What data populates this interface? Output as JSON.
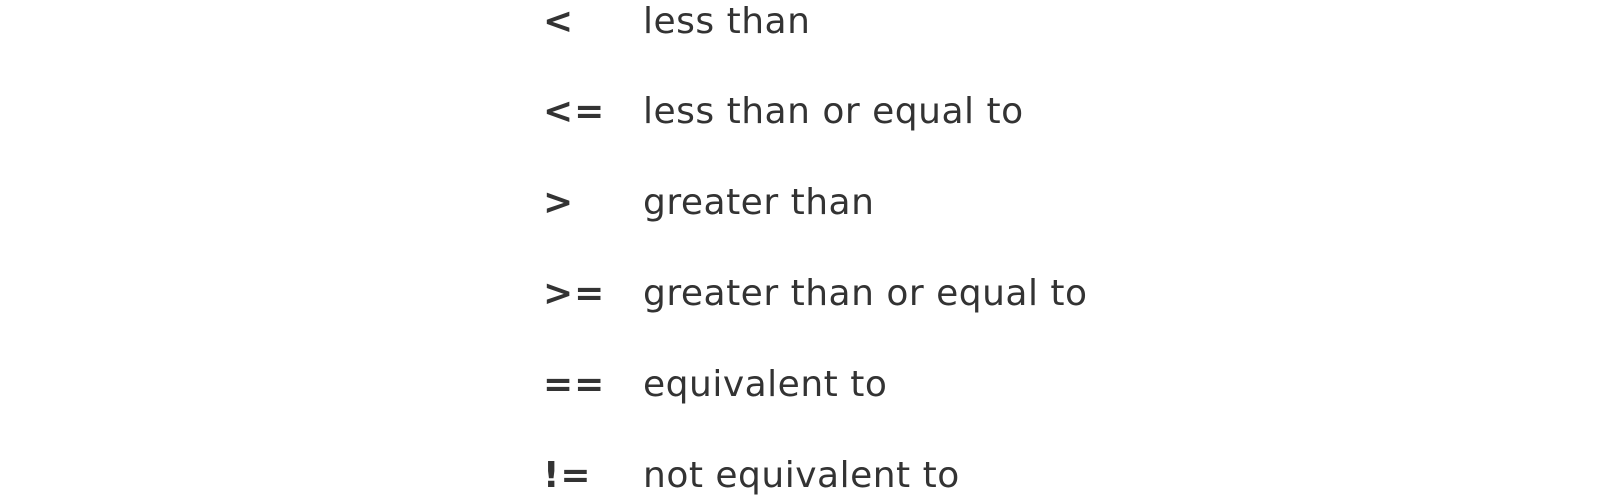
{
  "operators": [
    {
      "symbol": "<",
      "meaning": "less than"
    },
    {
      "symbol": "<=",
      "meaning": "less than or equal to"
    },
    {
      "symbol": ">",
      "meaning": "greater than"
    },
    {
      "symbol": ">=",
      "meaning": "greater than or equal to"
    },
    {
      "symbol": "==",
      "meaning": "equivalent to"
    },
    {
      "symbol": "!=",
      "meaning": "not equivalent to"
    }
  ]
}
